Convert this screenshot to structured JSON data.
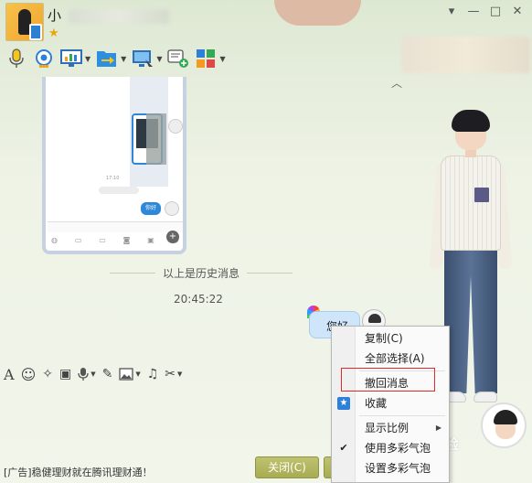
{
  "window": {
    "contact_name": "小",
    "controls": [
      "▾",
      "—",
      "□",
      "✕"
    ]
  },
  "toolbar": {
    "items": [
      {
        "icon": "microphone-icon",
        "caret": false
      },
      {
        "icon": "webcam-icon",
        "caret": false
      },
      {
        "icon": "screen-share-icon",
        "caret": true
      },
      {
        "icon": "file-transfer-icon",
        "caret": true
      },
      {
        "icon": "remote-desktop-icon",
        "caret": true
      },
      {
        "icon": "create-chat-icon",
        "caret": false
      },
      {
        "icon": "apps-icon",
        "caret": true
      }
    ]
  },
  "chat": {
    "screenshot": {
      "time": "17:10",
      "bubble": "你好"
    },
    "history_divider": "以上是历史消息",
    "timestamp": "20:45:22",
    "my_message": "您好"
  },
  "input_toolbar": {
    "items": [
      {
        "icon": "font-icon",
        "glyph": "A",
        "caret": false
      },
      {
        "icon": "emoji-icon",
        "glyph": "☺",
        "caret": false
      },
      {
        "icon": "magic-wand-icon",
        "glyph": "✧",
        "caret": false
      },
      {
        "icon": "video-clip-icon",
        "glyph": "▣",
        "caret": false
      },
      {
        "icon": "voice-message-icon",
        "glyph": "🎙",
        "caret": true
      },
      {
        "icon": "edit-icon",
        "glyph": "✎",
        "caret": false
      },
      {
        "icon": "image-icon",
        "glyph": "▨",
        "caret": true
      },
      {
        "icon": "music-icon",
        "glyph": "♫",
        "caret": false
      },
      {
        "icon": "scissors-icon",
        "glyph": "✂",
        "caret": true
      }
    ]
  },
  "context_menu": {
    "items": [
      {
        "label": "复制(C)",
        "icon": "",
        "submenu": false,
        "sep_after": false
      },
      {
        "label": "全部选择(A)",
        "icon": "",
        "submenu": false,
        "sep_after": true
      },
      {
        "label": "撤回消息",
        "icon": "",
        "submenu": false,
        "sep_after": false
      },
      {
        "label": "收藏",
        "icon": "star",
        "submenu": false,
        "sep_after": true
      },
      {
        "label": "显示比例",
        "icon": "",
        "submenu": true,
        "sep_after": false
      },
      {
        "label": "使用多彩气泡",
        "icon": "check",
        "submenu": false,
        "sep_after": false
      },
      {
        "label": "设置多彩气泡",
        "icon": "",
        "submenu": false,
        "sep_after": false
      }
    ]
  },
  "footer": {
    "ad": "[广告]稳健理财就在腾讯理财通！",
    "close_label": "关闭(C)"
  },
  "watermark": "经验"
}
